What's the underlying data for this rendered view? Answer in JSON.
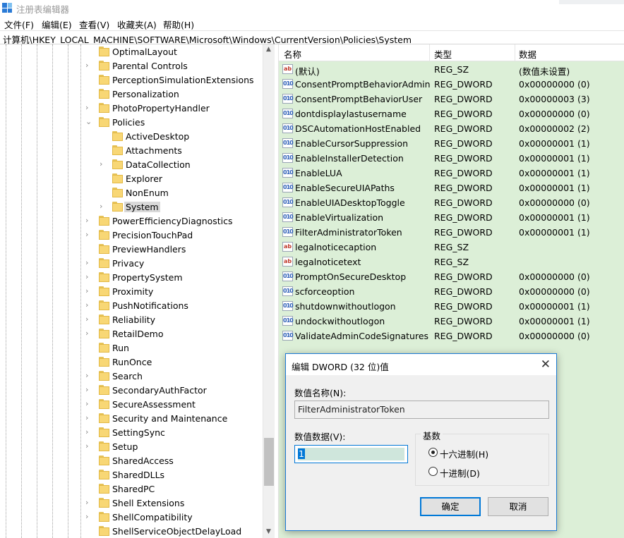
{
  "window": {
    "title": "注册表编辑器"
  },
  "menu": [
    "文件(F)",
    "编辑(E)",
    "查看(V)",
    "收藏夹(A)",
    "帮助(H)"
  ],
  "address": "计算机\\HKEY_LOCAL_MACHINE\\SOFTWARE\\Microsoft\\Windows\\CurrentVersion\\Policies\\System",
  "tree": [
    {
      "label": "OptimalLayout",
      "level": 0,
      "expander": "none"
    },
    {
      "label": "Parental Controls",
      "level": 0,
      "expander": "collapsed"
    },
    {
      "label": "PerceptionSimulationExtensions",
      "level": 0,
      "expander": "none"
    },
    {
      "label": "Personalization",
      "level": 0,
      "expander": "none"
    },
    {
      "label": "PhotoPropertyHandler",
      "level": 0,
      "expander": "collapsed"
    },
    {
      "label": "Policies",
      "level": 0,
      "expander": "expanded"
    },
    {
      "label": "ActiveDesktop",
      "level": 1,
      "expander": "none"
    },
    {
      "label": "Attachments",
      "level": 1,
      "expander": "none"
    },
    {
      "label": "DataCollection",
      "level": 1,
      "expander": "collapsed"
    },
    {
      "label": "Explorer",
      "level": 1,
      "expander": "none"
    },
    {
      "label": "NonEnum",
      "level": 1,
      "expander": "none"
    },
    {
      "label": "System",
      "level": 1,
      "expander": "collapsed",
      "selected": true
    },
    {
      "label": "PowerEfficiencyDiagnostics",
      "level": 0,
      "expander": "collapsed"
    },
    {
      "label": "PrecisionTouchPad",
      "level": 0,
      "expander": "collapsed"
    },
    {
      "label": "PreviewHandlers",
      "level": 0,
      "expander": "none"
    },
    {
      "label": "Privacy",
      "level": 0,
      "expander": "collapsed"
    },
    {
      "label": "PropertySystem",
      "level": 0,
      "expander": "collapsed"
    },
    {
      "label": "Proximity",
      "level": 0,
      "expander": "collapsed"
    },
    {
      "label": "PushNotifications",
      "level": 0,
      "expander": "collapsed"
    },
    {
      "label": "Reliability",
      "level": 0,
      "expander": "collapsed"
    },
    {
      "label": "RetailDemo",
      "level": 0,
      "expander": "collapsed"
    },
    {
      "label": "Run",
      "level": 0,
      "expander": "none"
    },
    {
      "label": "RunOnce",
      "level": 0,
      "expander": "none"
    },
    {
      "label": "Search",
      "level": 0,
      "expander": "collapsed"
    },
    {
      "label": "SecondaryAuthFactor",
      "level": 0,
      "expander": "collapsed"
    },
    {
      "label": "SecureAssessment",
      "level": 0,
      "expander": "collapsed"
    },
    {
      "label": "Security and Maintenance",
      "level": 0,
      "expander": "collapsed"
    },
    {
      "label": "SettingSync",
      "level": 0,
      "expander": "collapsed"
    },
    {
      "label": "Setup",
      "level": 0,
      "expander": "collapsed"
    },
    {
      "label": "SharedAccess",
      "level": 0,
      "expander": "none"
    },
    {
      "label": "SharedDLLs",
      "level": 0,
      "expander": "none"
    },
    {
      "label": "SharedPC",
      "level": 0,
      "expander": "none"
    },
    {
      "label": "Shell Extensions",
      "level": 0,
      "expander": "collapsed"
    },
    {
      "label": "ShellCompatibility",
      "level": 0,
      "expander": "collapsed"
    },
    {
      "label": "ShellServiceObjectDelayLoad",
      "level": 0,
      "expander": "none"
    }
  ],
  "list": {
    "columns": [
      "名称",
      "类型",
      "数据"
    ],
    "rows": [
      {
        "name": "(默认)",
        "type": "REG_SZ",
        "data": "(数值未设置)",
        "icon": "string-value-icon"
      },
      {
        "name": "ConsentPromptBehaviorAdmin",
        "type": "REG_DWORD",
        "data": "0x00000000 (0)",
        "icon": "dword-value-icon"
      },
      {
        "name": "ConsentPromptBehaviorUser",
        "type": "REG_DWORD",
        "data": "0x00000003 (3)",
        "icon": "dword-value-icon"
      },
      {
        "name": "dontdisplaylastusername",
        "type": "REG_DWORD",
        "data": "0x00000000 (0)",
        "icon": "dword-value-icon"
      },
      {
        "name": "DSCAutomationHostEnabled",
        "type": "REG_DWORD",
        "data": "0x00000002 (2)",
        "icon": "dword-value-icon"
      },
      {
        "name": "EnableCursorSuppression",
        "type": "REG_DWORD",
        "data": "0x00000001 (1)",
        "icon": "dword-value-icon"
      },
      {
        "name": "EnableInstallerDetection",
        "type": "REG_DWORD",
        "data": "0x00000001 (1)",
        "icon": "dword-value-icon"
      },
      {
        "name": "EnableLUA",
        "type": "REG_DWORD",
        "data": "0x00000001 (1)",
        "icon": "dword-value-icon"
      },
      {
        "name": "EnableSecureUIAPaths",
        "type": "REG_DWORD",
        "data": "0x00000001 (1)",
        "icon": "dword-value-icon"
      },
      {
        "name": "EnableUIADesktopToggle",
        "type": "REG_DWORD",
        "data": "0x00000000 (0)",
        "icon": "dword-value-icon"
      },
      {
        "name": "EnableVirtualization",
        "type": "REG_DWORD",
        "data": "0x00000001 (1)",
        "icon": "dword-value-icon"
      },
      {
        "name": "FilterAdministratorToken",
        "type": "REG_DWORD",
        "data": "0x00000001 (1)",
        "icon": "dword-value-icon"
      },
      {
        "name": "legalnoticecaption",
        "type": "REG_SZ",
        "data": "",
        "icon": "string-value-icon"
      },
      {
        "name": "legalnoticetext",
        "type": "REG_SZ",
        "data": "",
        "icon": "string-value-icon"
      },
      {
        "name": "PromptOnSecureDesktop",
        "type": "REG_DWORD",
        "data": "0x00000000 (0)",
        "icon": "dword-value-icon"
      },
      {
        "name": "scforceoption",
        "type": "REG_DWORD",
        "data": "0x00000000 (0)",
        "icon": "dword-value-icon"
      },
      {
        "name": "shutdownwithoutlogon",
        "type": "REG_DWORD",
        "data": "0x00000001 (1)",
        "icon": "dword-value-icon"
      },
      {
        "name": "undockwithoutlogon",
        "type": "REG_DWORD",
        "data": "0x00000001 (1)",
        "icon": "dword-value-icon"
      },
      {
        "name": "ValidateAdminCodeSignatures",
        "type": "REG_DWORD",
        "data": "0x00000000 (0)",
        "icon": "dword-value-icon"
      }
    ]
  },
  "dialog": {
    "title": "编辑 DWORD (32 位)值",
    "name_label": "数值名称(N):",
    "name_value": "FilterAdministratorToken",
    "data_label": "数值数据(V):",
    "data_value": "1",
    "radix_title": "基数",
    "radix_hex": "十六进制(H)",
    "radix_dec": "十进制(D)",
    "radix_selected": "hex",
    "ok": "确定",
    "cancel": "取消"
  },
  "colors": {
    "list_bg": "#dcefd7",
    "accent": "#0078d7",
    "selection": "#d9d9d9"
  }
}
